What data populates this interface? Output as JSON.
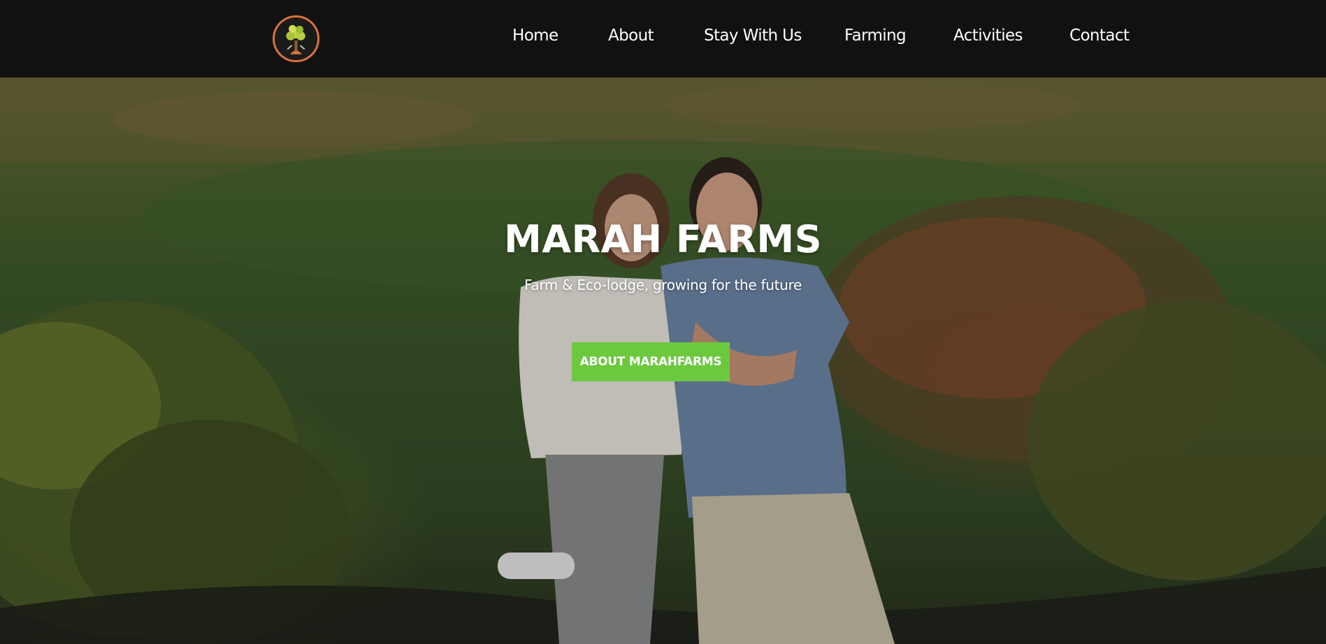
{
  "header": {
    "logo_icon": "tree-logo-icon",
    "nav": [
      {
        "label": "Home"
      },
      {
        "label": "About"
      },
      {
        "label": "Stay With Us"
      },
      {
        "label": "Farming"
      },
      {
        "label": "Activities"
      },
      {
        "label": "Contact"
      }
    ]
  },
  "hero": {
    "title": "MARAH FARMS",
    "subtitle": "Farm & Eco-lodge, growing for the future",
    "cta_label": "ABOUT MARAHFARMS"
  },
  "colors": {
    "header_bg": "#111111",
    "cta_bg": "#6cc83f",
    "logo_ring": "#d9733a"
  }
}
